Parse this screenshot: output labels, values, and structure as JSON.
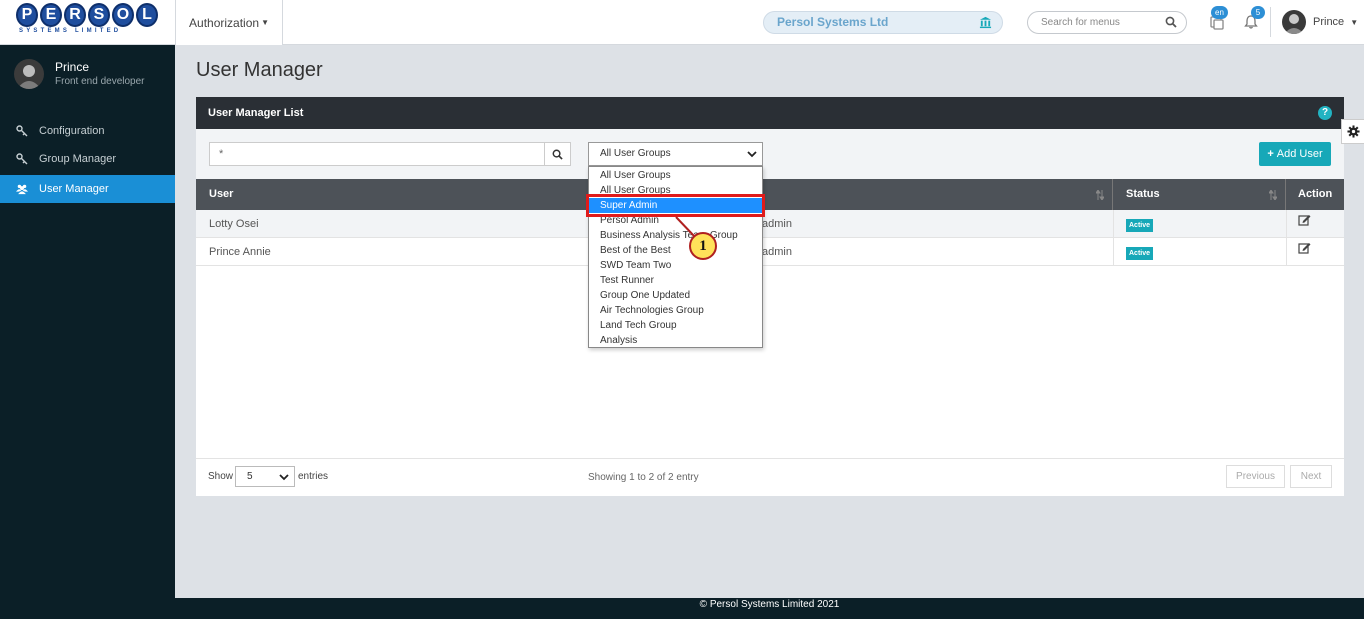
{
  "brand": {
    "letters": [
      "P",
      "E",
      "R",
      "S",
      "O",
      "L"
    ],
    "tagline": "SYSTEMS LIMITED",
    "color": "#1f4e9e"
  },
  "header": {
    "module": "Authorization",
    "company": "Persol Systems Ltd",
    "menu_search_placeholder": "Search for menus",
    "language_badge": "en",
    "notification_count": "5",
    "user": "Prince"
  },
  "sidebar": {
    "profile_name": "Prince",
    "profile_role": "Front end developer",
    "items": [
      {
        "label": "Configuration",
        "icon": "key-icon",
        "active": false
      },
      {
        "label": "Group Manager",
        "icon": "key-icon",
        "active": false
      },
      {
        "label": "User Manager",
        "icon": "users-icon",
        "active": true
      }
    ]
  },
  "page": {
    "title": "User Manager"
  },
  "list": {
    "card_title": "User Manager List",
    "search_value": "*",
    "group_filter": "All User Groups",
    "add_button": "Add User",
    "columns": [
      "User",
      "Status",
      "Action"
    ],
    "rows": [
      {
        "user": "Lotty Osei",
        "group": "admin",
        "status": "Active"
      },
      {
        "user": "Prince Annie",
        "group": "admin",
        "status": "Active"
      }
    ]
  },
  "footer_bar": {
    "show": "Show",
    "page_size": "5",
    "entries": "entries",
    "info": "Showing 1 to 2 of 2 entry",
    "previous": "Previous",
    "next": "Next"
  },
  "dropdown": {
    "options": [
      "All User Groups",
      "All User Groups",
      "Super Admin",
      "Persol Admin",
      "Business Analysis Team Group",
      "Best of the Best",
      "SWD Team Two",
      "Test Runner",
      "Group One Updated",
      "Air Technologies Group",
      "Land Tech Group",
      "Analysis"
    ],
    "selected_index": 2
  },
  "annotation": {
    "step": "1",
    "color": "#e01b1b"
  },
  "copyright": "© Persol Systems Limited 2021",
  "colors": {
    "accent": "#1a8fd6",
    "teal": "#17a8b8",
    "sidebar_bg": "#0b1f27",
    "header_dark": "#2a2f35"
  }
}
